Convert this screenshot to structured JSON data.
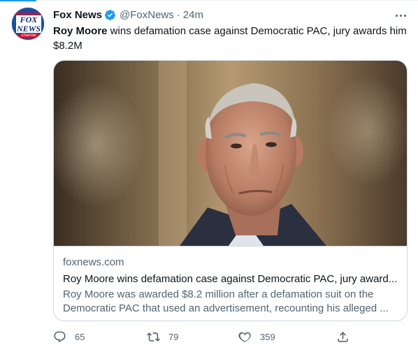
{
  "account": {
    "display_name": "Fox News",
    "handle": "@FoxNews",
    "separator": "·",
    "time": "24m",
    "avatar": {
      "logo_line1": "FOX",
      "logo_line2": "NEWS",
      "logo_line3": "channel"
    },
    "verified_icon": "verified-badge-icon"
  },
  "tweet": {
    "bold_text": "Roy Moore",
    "text": " wins defamation case against Democratic PAC, jury awards him $8.2M"
  },
  "card": {
    "image_icon": "news-photo",
    "domain": "foxnews.com",
    "title": "Roy Moore wins defamation case against Democratic PAC, jury award...",
    "description": "Roy Moore was awarded $8.2 million after a defamation suit on the Democratic PAC that used an advertisement, recounting his alleged ..."
  },
  "actions": {
    "reply_count": "65",
    "retweet_count": "79",
    "like_count": "359"
  },
  "colors": {
    "accent": "#1d9bf0",
    "text_primary": "#0f1419",
    "text_secondary": "#536471",
    "border": "#cfd9de"
  }
}
